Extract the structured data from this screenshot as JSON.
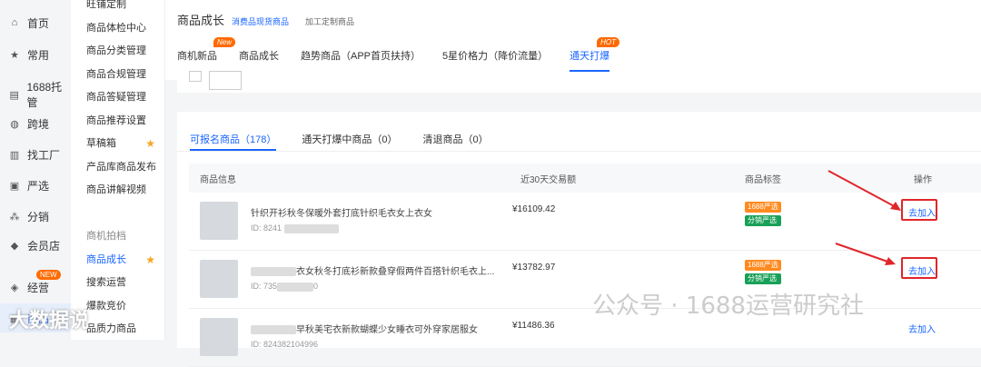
{
  "left_nav": {
    "items": [
      {
        "label": "首页",
        "icon": "home-icon",
        "glyph": "⌂"
      },
      {
        "label": "常用",
        "icon": "star-icon",
        "glyph": "★"
      },
      {
        "label": "1688托管",
        "icon": "hosting-icon",
        "glyph": "▤"
      },
      {
        "label": "跨境",
        "icon": "globe-icon",
        "glyph": "◍"
      },
      {
        "label": "找工厂",
        "icon": "factory-icon",
        "glyph": "▥"
      },
      {
        "label": "严选",
        "icon": "strict-select-icon",
        "glyph": "▣"
      },
      {
        "label": "分销",
        "icon": "distribution-icon",
        "glyph": "⁂"
      },
      {
        "label": "会员店",
        "icon": "member-store-icon",
        "glyph": "◆"
      },
      {
        "label": "经营",
        "icon": "operations-icon",
        "glyph": "◈"
      },
      {
        "label": "商品",
        "icon": "product-icon",
        "glyph": "▦"
      }
    ],
    "new_badge": "NEW"
  },
  "sub_nav": {
    "items": [
      {
        "label": "旺铺定制"
      },
      {
        "label": "商品体检中心"
      },
      {
        "label": "商品分类管理"
      },
      {
        "label": "商品合规管理"
      },
      {
        "label": "商品答疑管理"
      },
      {
        "label": "商品推荐设置"
      },
      {
        "label": "草稿箱",
        "star": true
      },
      {
        "label": "产品库商品发布"
      },
      {
        "label": "商品讲解视频"
      },
      {
        "label": ""
      },
      {
        "label": "商机拍档"
      },
      {
        "label": "商品成长",
        "star": true
      },
      {
        "label": "搜索运营"
      },
      {
        "label": "爆款竞价"
      },
      {
        "label": "品质力商品"
      }
    ]
  },
  "header": {
    "title": "商品成长",
    "crumbs": [
      "消费品现货商品",
      "加工定制商品"
    ],
    "tabs": [
      {
        "label": "商机新品",
        "tag": "New"
      },
      {
        "label": "商品成长"
      },
      {
        "label": "趋势商品（APP首页扶持）"
      },
      {
        "label": "5星价格力（降价流量）"
      },
      {
        "label": "通天打爆",
        "tag": "HOT"
      }
    ]
  },
  "panel": {
    "tabs": [
      {
        "label": "可报名商品（178）"
      },
      {
        "label": "通天打爆中商品（0）"
      },
      {
        "label": "清退商品（0）"
      }
    ],
    "columns": [
      "商品信息",
      "近30天交易额",
      "商品标签",
      "操作"
    ],
    "rows": [
      {
        "name": "针织开衫秋冬保暖外套打底针织毛衣女上衣女",
        "id": "ID: 8241",
        "amount": "¥16109.42",
        "badges": [
          "1688严选",
          "分销严选"
        ],
        "action": "去加入"
      },
      {
        "name": "衣女秋冬打底衫新款叠穿假两件百搭针织毛衣上...",
        "id": "ID: 735",
        "id_suffix": "0",
        "amount": "¥13782.97",
        "badges": [
          "1688严选",
          "分销严选"
        ],
        "action": "去加入"
      },
      {
        "name": "早秋美宅衣新款蝴蝶少女睡衣可外穿家居服女",
        "id": "ID: 824382104996",
        "amount": "¥11486.36",
        "badges": [],
        "action": "去加入"
      }
    ]
  },
  "watermark": {
    "text": "公众号 · 1688运营研究社",
    "logo_text": "大数据说"
  }
}
